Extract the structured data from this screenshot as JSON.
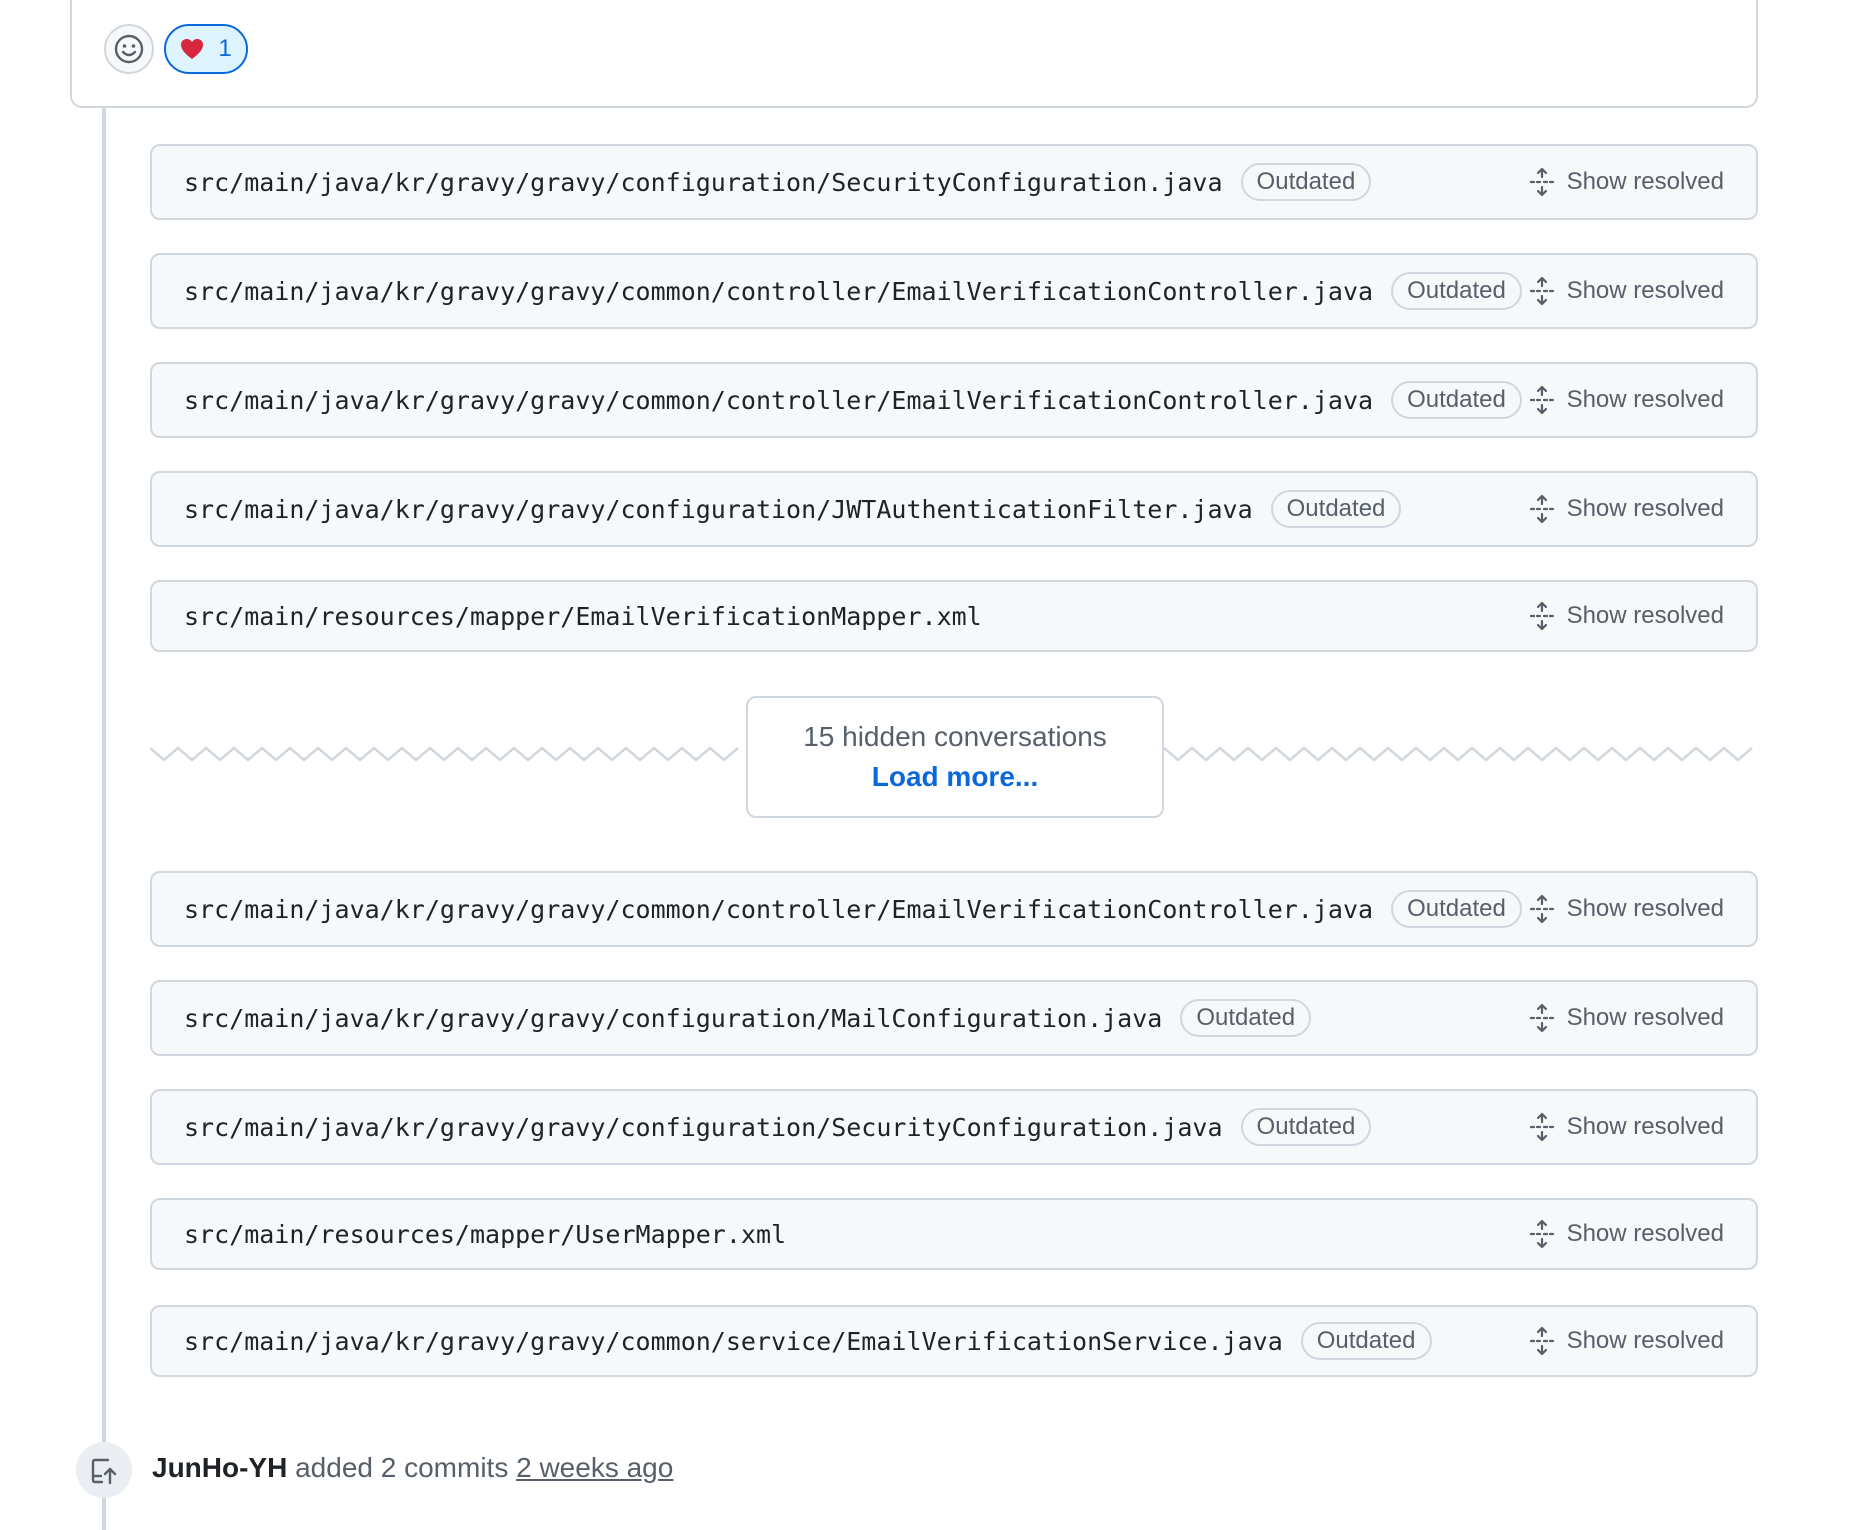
{
  "comment": {
    "reactions": [
      {
        "icon": "heart-emoji",
        "count": "1"
      }
    ]
  },
  "threads_top": [
    {
      "path": "src/main/java/kr/gravy/gravy/configuration/SecurityConfiguration.java",
      "badge": "Outdated",
      "action": "Show resolved"
    },
    {
      "path": "src/main/java/kr/gravy/gravy/common/controller/EmailVerificationController.java",
      "badge": "Outdated",
      "action": "Show resolved"
    },
    {
      "path": "src/main/java/kr/gravy/gravy/common/controller/EmailVerificationController.java",
      "badge": "Outdated",
      "action": "Show resolved"
    },
    {
      "path": "src/main/java/kr/gravy/gravy/configuration/JWTAuthenticationFilter.java",
      "badge": "Outdated",
      "action": "Show resolved"
    },
    {
      "path": "src/main/resources/mapper/EmailVerificationMapper.xml",
      "badge": "",
      "action": "Show resolved"
    }
  ],
  "hidden": {
    "count_text": "15 hidden conversations",
    "load_more": "Load more..."
  },
  "threads_bottom": [
    {
      "path": "src/main/java/kr/gravy/gravy/common/controller/EmailVerificationController.java",
      "badge": "Outdated",
      "action": "Show resolved"
    },
    {
      "path": "src/main/java/kr/gravy/gravy/configuration/MailConfiguration.java",
      "badge": "Outdated",
      "action": "Show resolved"
    },
    {
      "path": "src/main/java/kr/gravy/gravy/configuration/SecurityConfiguration.java",
      "badge": "Outdated",
      "action": "Show resolved"
    },
    {
      "path": "src/main/resources/mapper/UserMapper.xml",
      "badge": "",
      "action": "Show resolved"
    },
    {
      "path": "src/main/java/kr/gravy/gravy/common/service/EmailVerificationService.java",
      "badge": "Outdated",
      "action": "Show resolved"
    }
  ],
  "event": {
    "icon": "push-commits-icon",
    "author": "JunHo-YH",
    "action": "added 2 commits",
    "time": "2 weeks ago"
  },
  "colors": {
    "accent": "#0969da",
    "border": "#d0d7de",
    "muted_text": "#57606a",
    "thread_bg": "#f6f8fa"
  }
}
